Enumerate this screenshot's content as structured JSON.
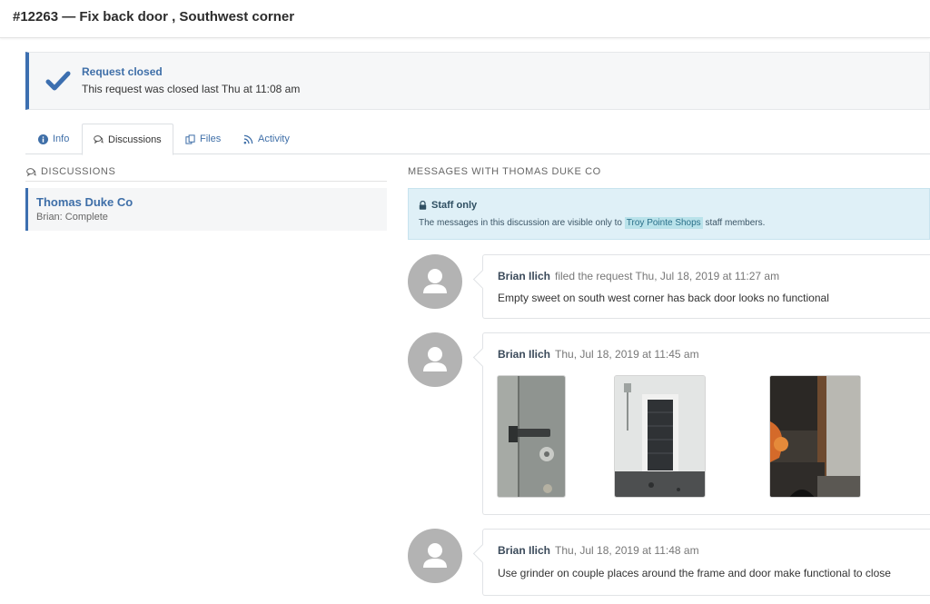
{
  "header": {
    "title": "#12263 — Fix back door , Southwest corner"
  },
  "banner": {
    "title": "Request closed",
    "text": "This request was closed last Thu at 11:08 am",
    "accent": "#3c6fb0"
  },
  "tabs": [
    {
      "label": "Info",
      "icon": "info-icon"
    },
    {
      "label": "Discussions",
      "icon": "chat-icon",
      "active": true
    },
    {
      "label": "Files",
      "icon": "files-icon"
    },
    {
      "label": "Activity",
      "icon": "rss-icon"
    }
  ],
  "discussions": {
    "heading": "DISCUSSIONS",
    "items": [
      {
        "name": "Thomas Duke Co",
        "subtitle": "Brian: Complete"
      }
    ]
  },
  "messages_panel": {
    "heading": "MESSAGES WITH THOMAS DUKE CO",
    "staff_notice": {
      "title": "Staff only",
      "text_before": "The messages in this discussion are visible only to",
      "link": "Troy Pointe Shops",
      "text_after": "staff members."
    },
    "messages": [
      {
        "author": "Brian Ilich",
        "meta": "filed the request Thu, Jul 18, 2019 at 11:27 am",
        "body": "Empty sweet on south west corner has back door looks no functional"
      },
      {
        "author": "Brian Ilich",
        "meta": "Thu, Jul 18, 2019 at 11:45 am",
        "body": ""
      },
      {
        "author": "Brian Ilich",
        "meta": "Thu, Jul 18, 2019 at 11:48 am",
        "body": "Use grinder on couple places around the frame and door make functional to close"
      }
    ]
  }
}
